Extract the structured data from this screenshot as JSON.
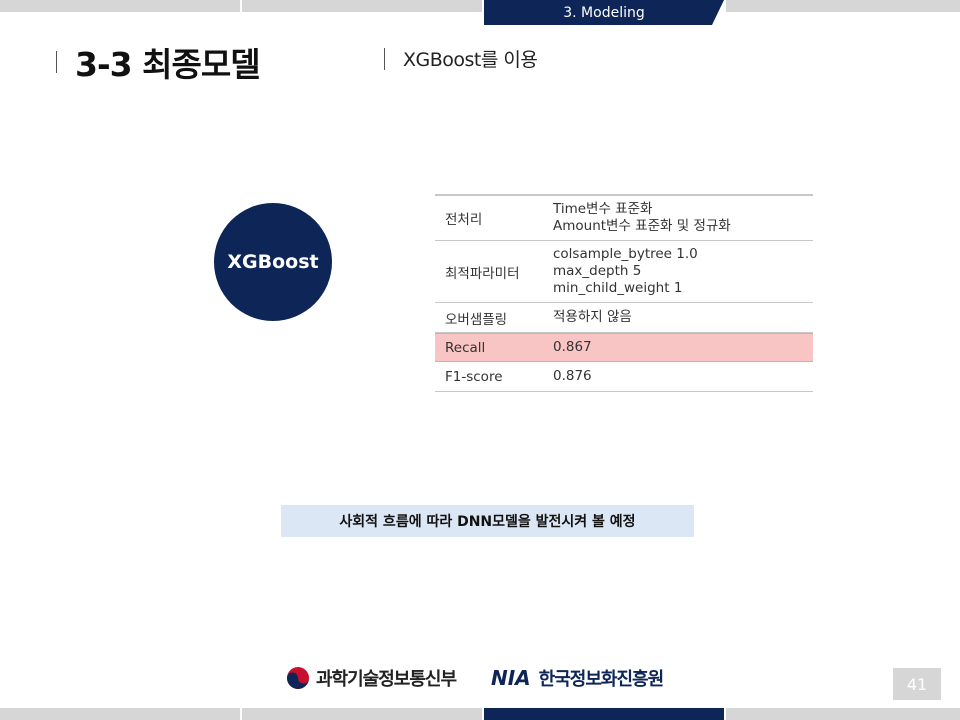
{
  "header": {
    "section_label": "3. Modeling",
    "title": "3-3 최종모델",
    "subtitle": "XGBoost를 이용"
  },
  "model_badge": "XGBoost",
  "table": {
    "rows": [
      {
        "key": "전처리",
        "values": [
          "Time변수 표준화",
          "Amount변수 표준화 및 정규화"
        ]
      },
      {
        "key": "최적파라미터",
        "values": [
          "colsample_bytree 1.0",
          "max_depth 5",
          "min_child_weight 1"
        ]
      },
      {
        "key": "오버샘플링",
        "values": [
          "적용하지 않음"
        ]
      },
      {
        "key": "Recall",
        "values": [
          "0.867"
        ]
      },
      {
        "key": "F1-score",
        "values": [
          "0.876"
        ]
      }
    ]
  },
  "note": "사회적 흐름에 따라 DNN모델을 발전시켜 볼 예정",
  "footer": {
    "logo1_text": "과학기술정보통신부",
    "logo2_abbr": "NIA",
    "logo2_text": "한국정보화진흥원",
    "page_number": "41"
  },
  "colors": {
    "navy": "#0e2557",
    "highlight": "#f9c4c4",
    "note_bg": "#dce7f5"
  }
}
